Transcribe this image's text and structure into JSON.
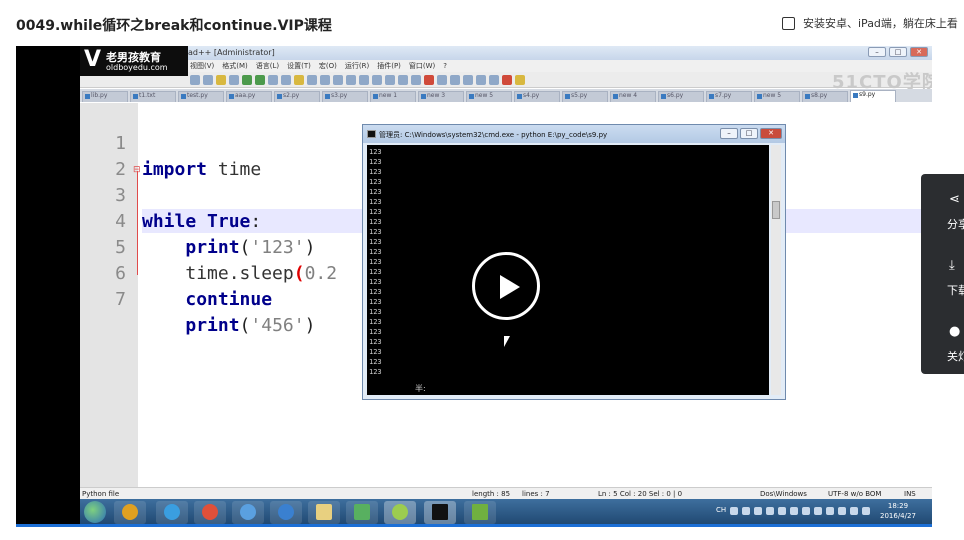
{
  "page": {
    "course_title": "0049.while循环之break和continue.VIP课程",
    "app_promo": "安装安卓、iPad端，躺在床上看"
  },
  "desktop": {
    "logo_name": "老男孩教育",
    "logo_url": "oldboyedu.com",
    "notepad_title": "ad++ [Administrator]",
    "watermark": "51CTO学院",
    "menus": [
      "视图(V)",
      "格式(M)",
      "语言(L)",
      "设置(T)",
      "宏(O)",
      "运行(R)",
      "插件(P)",
      "窗口(W)",
      "?"
    ],
    "tabs": [
      "lib.py",
      "t1.txt",
      "test.py",
      "aaa.py",
      "s2.py",
      "s3.py",
      "new 1",
      "new 3",
      "new 5",
      "s4.py",
      "s5.py",
      "new 4",
      "s6.py",
      "s7.py",
      "new 5",
      "s8.py",
      "s9.py"
    ],
    "active_tab": "s9.py",
    "code_lines": [
      {
        "n": "1",
        "text": "import time"
      },
      {
        "n": "2",
        "text": ""
      },
      {
        "n": "3",
        "text": "while True:"
      },
      {
        "n": "4",
        "text": "    print('123')"
      },
      {
        "n": "5",
        "text": "    time.sleep(0.2"
      },
      {
        "n": "6",
        "text": "    continue"
      },
      {
        "n": "7",
        "text": "    print('456')"
      }
    ],
    "cmd": {
      "title": "管理员: C:\\Windows\\system32\\cmd.exe - python  E:\\py_code\\s9.py",
      "output_line": "123",
      "status": "半:"
    },
    "status_bar": {
      "file_type": "Python file",
      "length": "length : 85",
      "lines": "lines : 7",
      "position": "Ln : 5    Col : 20    Sel : 0 | 0",
      "eol": "Dos\\Windows",
      "encoding": "UTF-8 w/o BOM",
      "mode": "INS"
    },
    "taskbar": {
      "tray_label": "CH",
      "time": "18:29",
      "date": "2016/4/27"
    }
  },
  "side_panel": {
    "items": [
      {
        "icon": "share-icon",
        "label": "分享"
      },
      {
        "icon": "download-icon",
        "label": "下载"
      },
      {
        "icon": "lightbulb-icon",
        "label": "关灯"
      }
    ]
  }
}
